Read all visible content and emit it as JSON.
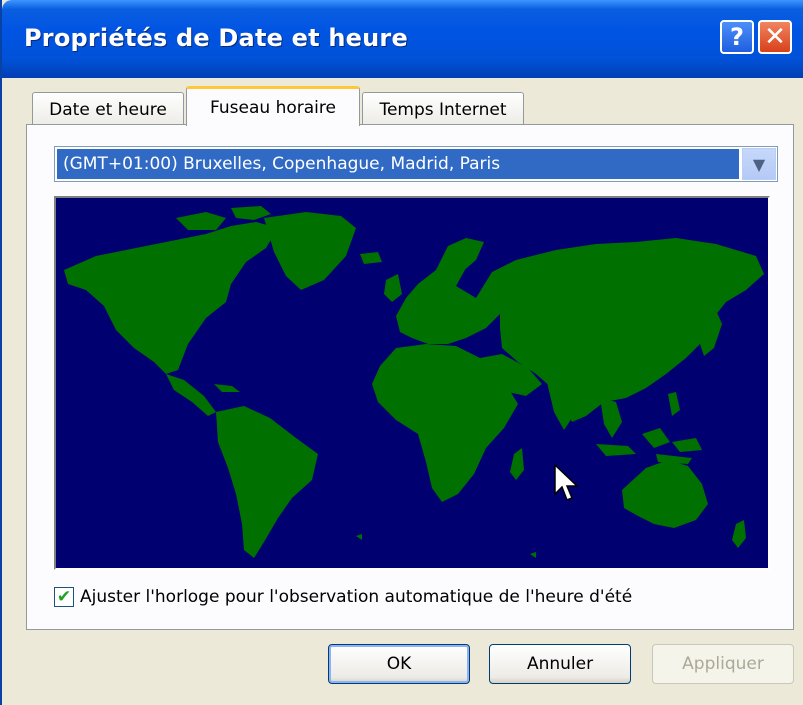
{
  "window": {
    "title": "Propriétés de Date et heure",
    "help_glyph": "?",
    "close_glyph": "✕"
  },
  "tabs": [
    {
      "label": "Date et heure",
      "active": false
    },
    {
      "label": "Fuseau horaire",
      "active": true
    },
    {
      "label": "Temps Internet",
      "active": false
    }
  ],
  "timezone": {
    "selected": "(GMT+01:00) Bruxelles, Copenhague, Madrid, Paris",
    "arrow_glyph": "▼"
  },
  "map": {
    "ocean_color": "#000070",
    "land_color": "#007000"
  },
  "dst": {
    "checked": true,
    "check_glyph": "✔",
    "label": "Ajuster l'horloge pour l'observation automatique de l'heure d'été"
  },
  "buttons": {
    "ok": "OK",
    "cancel": "Annuler",
    "apply": "Appliquer"
  }
}
